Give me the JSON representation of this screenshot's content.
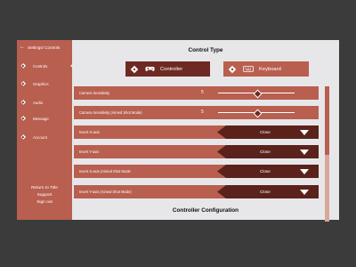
{
  "sidebar": {
    "breadcrumb": "Settings/ Controls",
    "items": [
      {
        "label": "Controls"
      },
      {
        "label": "Graphics"
      },
      {
        "label": "Audio"
      },
      {
        "label": "Message"
      },
      {
        "label": "Account"
      }
    ],
    "bottom_links": [
      "Return to Title",
      "Support",
      "Sign out"
    ]
  },
  "main": {
    "control_type_title": "Control Type",
    "controller_label": "Controller",
    "keyboard_label": "Keyboard",
    "sliders": [
      {
        "label": "Camera Sensitivity",
        "value": "5",
        "level": 0.5
      },
      {
        "label": "Camera Sensitivity (Aimed Shot Mode)",
        "value": "5",
        "level": 0.5
      }
    ],
    "dropdowns": [
      {
        "label": "Invert X-axis",
        "value": "Close"
      },
      {
        "label": "Invert Y-axis",
        "value": "Close"
      },
      {
        "label": "Invert X-axis (Aimed Shot Mode",
        "value": "Close"
      },
      {
        "label": "Invert Y-axis (Aimed Shot Mode)",
        "value": "Close"
      }
    ],
    "config_title": "Controller Configuration"
  },
  "colors": {
    "accent": "#b85f4f",
    "accent_dark": "#6e2a22",
    "panel": "#e7e7ea",
    "background": "#3b3b3b"
  }
}
